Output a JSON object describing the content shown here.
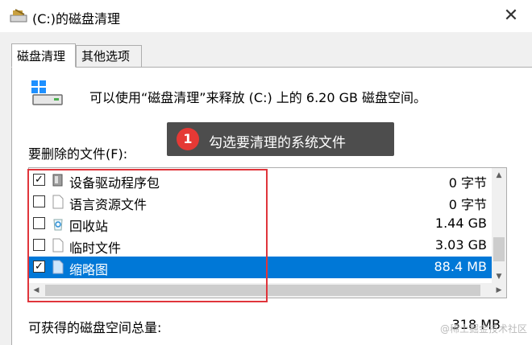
{
  "window": {
    "title": "(C:)的磁盘清理",
    "close_glyph": "✕"
  },
  "tabs": [
    {
      "label": "磁盘清理",
      "active": true
    },
    {
      "label": "其他选项",
      "active": false
    }
  ],
  "summary_text": "可以使用“磁盘清理”来释放 (C:) 上的 6.20 GB 磁盘空间。",
  "tooltip": {
    "number": "1",
    "text": "勾选要清理的系统文件"
  },
  "files_label": "要删除的文件(F):",
  "files": [
    {
      "name": "设备驱动程序包",
      "size": "0 字节",
      "checked": true,
      "icon": "driver-package-icon"
    },
    {
      "name": "语言资源文件",
      "size": "0 字节",
      "checked": false,
      "icon": "file-icon"
    },
    {
      "name": "回收站",
      "size": "1.44 GB",
      "checked": false,
      "icon": "recycle-bin-icon"
    },
    {
      "name": "临时文件",
      "size": "3.03 GB",
      "checked": false,
      "icon": "file-icon"
    },
    {
      "name": "缩略图",
      "size": "88.4 MB",
      "checked": true,
      "selected": true,
      "icon": "file-icon"
    }
  ],
  "total": {
    "label": "可获得的磁盘空间总量:",
    "value": "318 MB"
  },
  "watermark": "@稀土掘金技术社区",
  "colors": {
    "selection": "#0078d7",
    "annotation_red": "#e0353b",
    "tooltip_bg": "#4d4d4d"
  }
}
